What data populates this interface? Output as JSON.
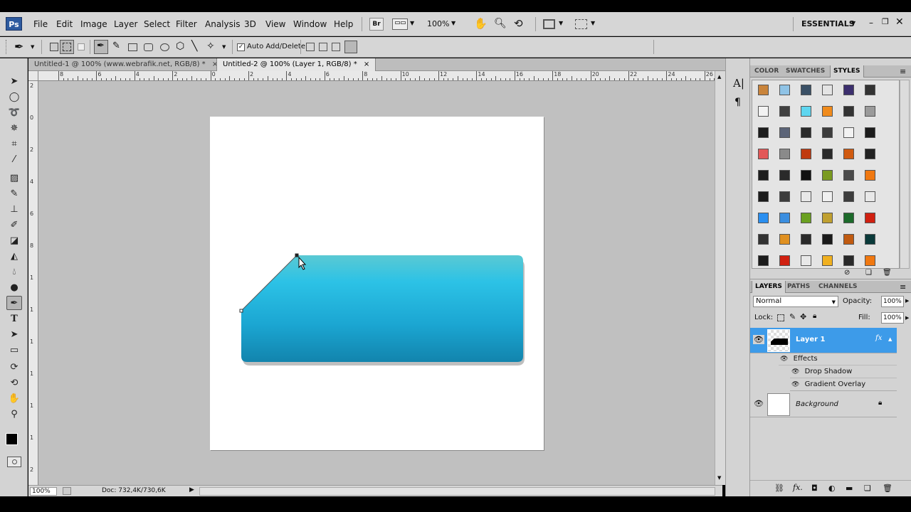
{
  "app": {
    "logo": "Ps"
  },
  "menu": [
    "File",
    "Edit",
    "Image",
    "Layer",
    "Select",
    "Filter",
    "Analysis",
    "3D",
    "View",
    "Window",
    "Help"
  ],
  "appbar": {
    "bridge": "Br",
    "zoom": "100%",
    "workspace": "ESSENTIALS"
  },
  "options": {
    "auto_add_delete": "Auto Add/Delete"
  },
  "tabs": [
    {
      "label": "Untitled-1 @ 100% (www.webrafik.net, RGB/8) *",
      "close": "×"
    },
    {
      "label": "Untitled-2 @ 100% (Layer 1, RGB/8) *",
      "close": "×"
    }
  ],
  "ruler_top": [
    "8",
    "6",
    "4",
    "2",
    "0",
    "2",
    "4",
    "6",
    "8",
    "10",
    "12",
    "14",
    "16",
    "18",
    "20",
    "22",
    "24",
    "26"
  ],
  "ruler_left": [
    "2",
    "0",
    "2",
    "4",
    "6",
    "8",
    "1",
    "1",
    "1",
    "1",
    "1",
    "1",
    "2"
  ],
  "status": {
    "zoom": "100%",
    "doc": "Doc: 732,4K/730,6K"
  },
  "styles_panel": {
    "tabs": [
      "COLOR",
      "SWATCHES",
      "STYLES"
    ]
  },
  "layers_panel": {
    "tabs": [
      "LAYERS",
      "PATHS",
      "CHANNELS"
    ],
    "blend_mode": "Normal",
    "opacity_label": "Opacity:",
    "opacity": "100%",
    "lock_label": "Lock:",
    "fill_label": "Fill:",
    "fill": "100%",
    "layers": [
      {
        "name": "Layer 1",
        "fx": "fx",
        "effects_label": "Effects",
        "effects": [
          "Drop Shadow",
          "Gradient Overlay"
        ]
      },
      {
        "name": "Background"
      }
    ]
  },
  "colors": {
    "ui_bg": "#d6d6d6",
    "selection": "#3d9be9",
    "shape_top": "#3fc4de",
    "shape_bottom": "#1289b4"
  }
}
